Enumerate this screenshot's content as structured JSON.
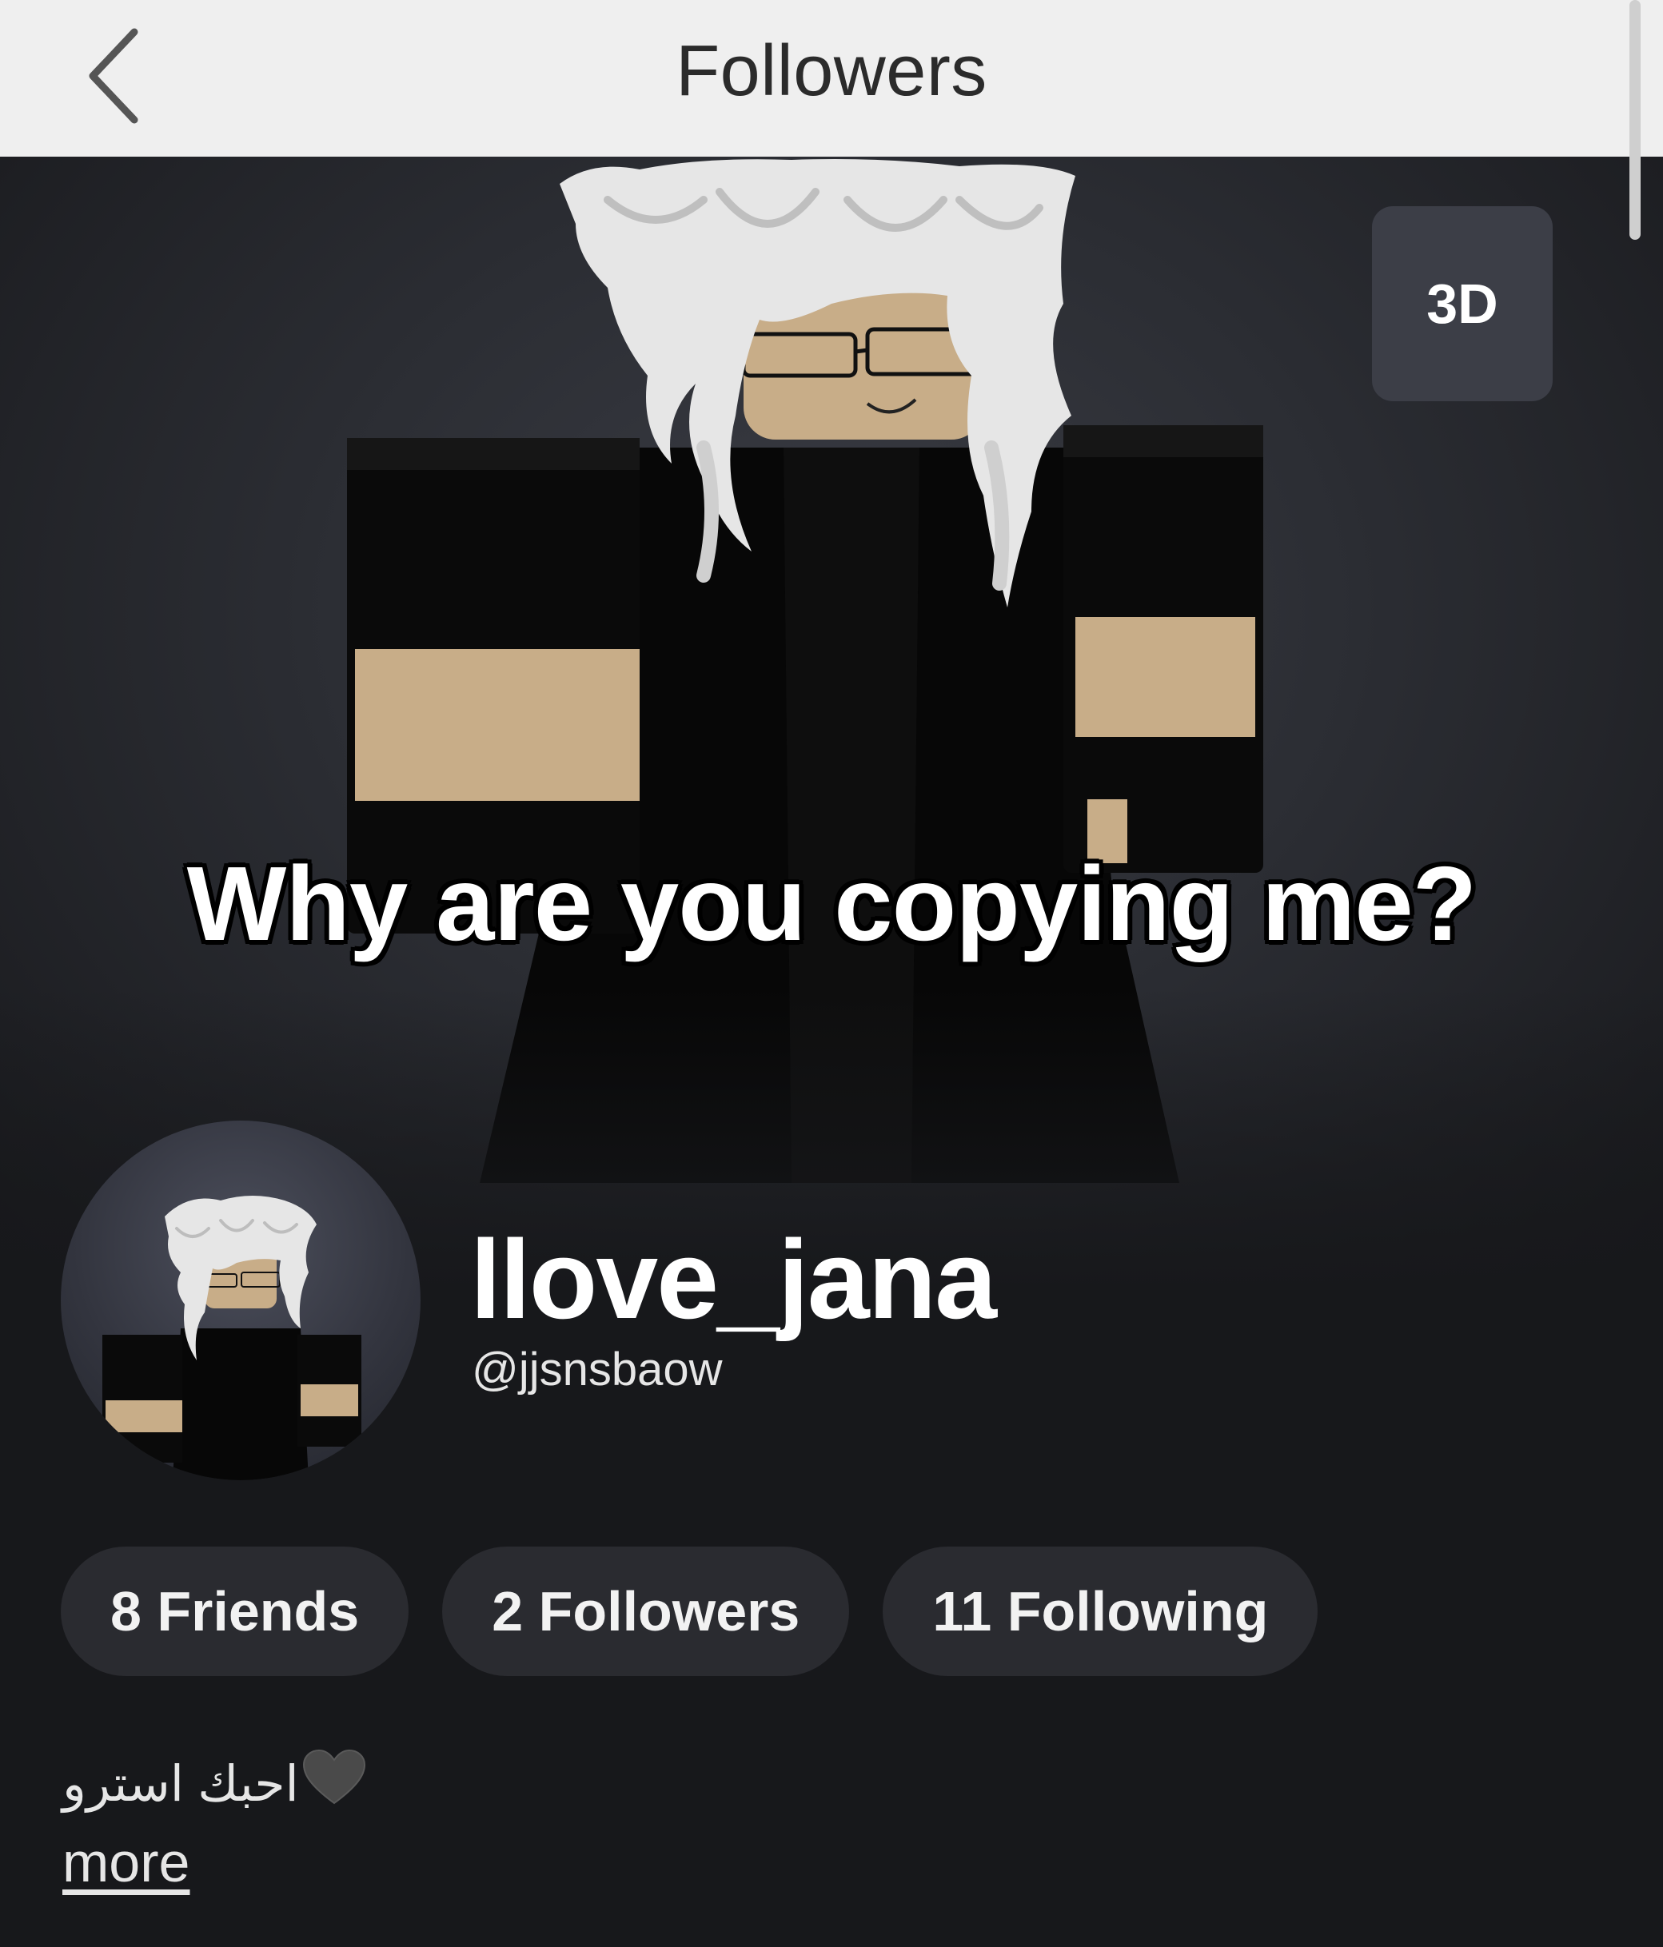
{
  "nav": {
    "title": "Followers",
    "back_icon": "chevron-left-icon"
  },
  "hero": {
    "view_toggle_label": "3D",
    "caption": "Why are you copying me?"
  },
  "profile": {
    "display_name": "llove_jana",
    "username": "@jjsnsbaow",
    "stats": {
      "friends": "8 Friends",
      "followers": "2 Followers",
      "following": "11 Following"
    },
    "bio_text": "احبك استرو",
    "bio_icon": "black-heart-icon",
    "more_label": "more"
  },
  "colors": {
    "topbar": "#efefef",
    "background": "#17181b",
    "pill": "#2a2b30",
    "threed_button": "#3c3e47",
    "text": "#ffffff"
  }
}
